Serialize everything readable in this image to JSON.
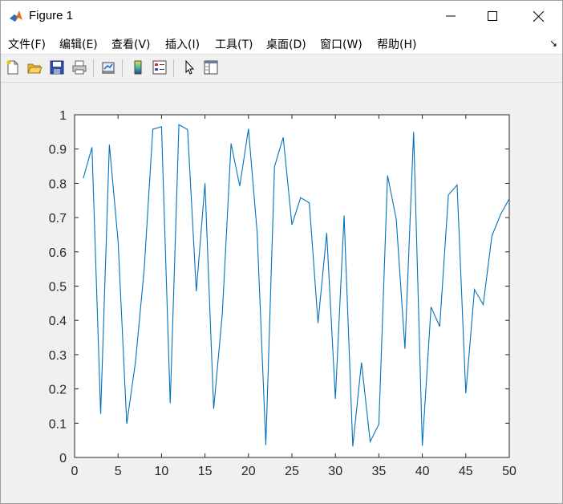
{
  "window": {
    "title": "Figure 1"
  },
  "menu": [
    "文件(F)",
    "编辑(E)",
    "查看(V)",
    "插入(I)",
    "工具(T)",
    "桌面(D)",
    "窗口(W)",
    "帮助(H)"
  ],
  "toolbar_icons": [
    "new-figure-icon",
    "open-file-icon",
    "save-icon",
    "print-icon",
    "link-plot-icon",
    "insert-colorbar-icon",
    "insert-legend-icon",
    "edit-plot-icon",
    "property-inspector-icon"
  ],
  "colors": {
    "line": "#0072bd",
    "axes_bg": "#ffffff",
    "figure_bg": "#f0f0f0"
  },
  "chart_data": {
    "type": "line",
    "x": [
      1,
      2,
      3,
      4,
      5,
      6,
      7,
      8,
      9,
      10,
      11,
      12,
      13,
      14,
      15,
      16,
      17,
      18,
      19,
      20,
      21,
      22,
      23,
      24,
      25,
      26,
      27,
      28,
      29,
      30,
      31,
      32,
      33,
      34,
      35,
      36,
      37,
      38,
      39,
      40,
      41,
      42,
      43,
      44,
      45,
      46,
      47,
      48,
      49,
      50
    ],
    "series": [
      {
        "values": [
          0.815,
          0.905,
          0.127,
          0.913,
          0.632,
          0.098,
          0.278,
          0.547,
          0.958,
          0.965,
          0.158,
          0.971,
          0.957,
          0.485,
          0.8,
          0.142,
          0.422,
          0.916,
          0.792,
          0.959,
          0.656,
          0.036,
          0.849,
          0.934,
          0.679,
          0.758,
          0.743,
          0.392,
          0.655,
          0.171,
          0.706,
          0.032,
          0.277,
          0.046,
          0.097,
          0.823,
          0.695,
          0.317,
          0.95,
          0.034,
          0.439,
          0.382,
          0.766,
          0.795,
          0.187,
          0.49,
          0.446,
          0.646,
          0.709,
          0.755
        ]
      }
    ],
    "xlim": [
      0,
      50
    ],
    "ylim": [
      0,
      1
    ],
    "xticks": [
      "0",
      "5",
      "10",
      "15",
      "20",
      "25",
      "30",
      "35",
      "40",
      "45",
      "50"
    ],
    "yticks": [
      "0",
      "0.1",
      "0.2",
      "0.3",
      "0.4",
      "0.5",
      "0.6",
      "0.7",
      "0.8",
      "0.9",
      "1"
    ]
  }
}
